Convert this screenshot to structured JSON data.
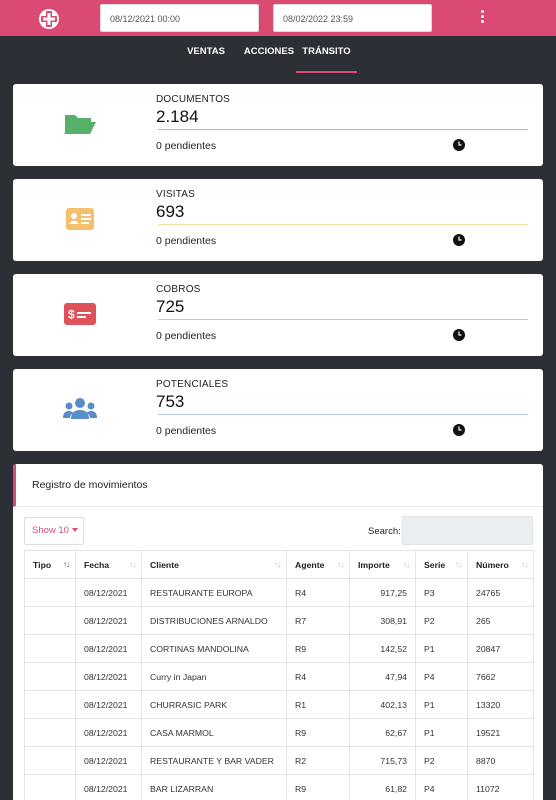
{
  "header": {
    "date_from": "08/12/2021 00:00",
    "date_to": "08/02/2022 23:59",
    "brand_color": "#db4a72",
    "logo_icon": "app-logo-icon",
    "menu_icon": "kebab-menu-icon"
  },
  "tabs": [
    {
      "label": "VENTAS",
      "active": false
    },
    {
      "label": "ACCIONES",
      "active": false
    },
    {
      "label": "TRÁNSITO",
      "active": true
    }
  ],
  "cards": [
    {
      "title": "DOCUMENTOS",
      "value": "2.184",
      "pending": "0 pendientes",
      "icon": "folder-open-icon",
      "color": "#56b06a",
      "line_color": "#9ccaa5"
    },
    {
      "title": "VISITAS",
      "value": "693",
      "pending": "0 pendientes",
      "icon": "id-card-icon",
      "color": "#f5c06b",
      "line_color": "#f6dca5"
    },
    {
      "title": "COBROS",
      "value": "725",
      "pending": "0 pendientes",
      "icon": "payment-card-icon",
      "color": "#e0525a",
      "line_color": "#efb3b8"
    },
    {
      "title": "POTENCIALES",
      "value": "753",
      "pending": "0 pendientes",
      "icon": "users-icon",
      "color": "#5a8cc7",
      "line_color": "#b3c9e4"
    }
  ],
  "table_panel": {
    "title": "Registro de movimientos",
    "show_label": "Show 10",
    "search_label": "Search:",
    "search_value": "",
    "columns": [
      "Tipo",
      "Fecha",
      "Cliente",
      "Agente",
      "Importe",
      "Serie",
      "Número"
    ],
    "rows": [
      [
        "",
        "08/12/2021",
        "RESTAURANTE EUROPA",
        "R4",
        "917,25",
        "P3",
        "24765"
      ],
      [
        "",
        "08/12/2021",
        "DISTRIBUCIONES ARNALDO",
        "R7",
        "308,91",
        "P2",
        "265"
      ],
      [
        "",
        "08/12/2021",
        "CORTINAS MANDOLINA",
        "R9",
        "142,52",
        "P1",
        "20847"
      ],
      [
        "",
        "08/12/2021",
        "Curry in Japan",
        "R4",
        "47,94",
        "P4",
        "7662"
      ],
      [
        "",
        "08/12/2021",
        "CHURRASIC PARK",
        "R1",
        "402,13",
        "P1",
        "13320"
      ],
      [
        "",
        "08/12/2021",
        "CASA MARMOL",
        "R9",
        "62,67",
        "P1",
        "19521"
      ],
      [
        "",
        "08/12/2021",
        "RESTAURANTE Y BAR VADER",
        "R2",
        "715,73",
        "P2",
        "8870"
      ],
      [
        "",
        "08/12/2021",
        "BAR LIZARRAN",
        "R9",
        "61,82",
        "P4",
        "11072"
      ]
    ]
  }
}
